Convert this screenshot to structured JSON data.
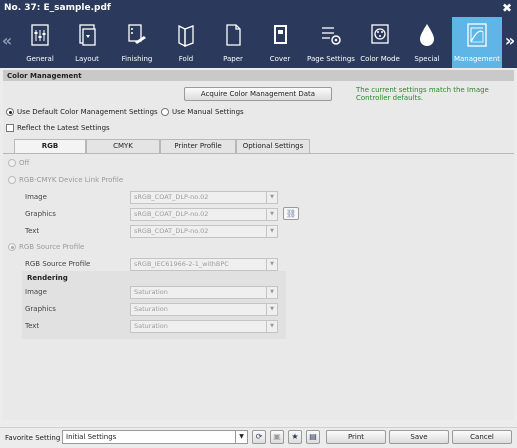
{
  "window": {
    "title": "No. 37: E_sample.pdf",
    "close_glyph": "✖"
  },
  "toolbar": {
    "nav_left_glyph": "«",
    "nav_right_glyph": "»",
    "items": [
      {
        "label": "General",
        "icon": "general-icon"
      },
      {
        "label": "Layout",
        "icon": "layout-icon"
      },
      {
        "label": "Finishing",
        "icon": "finishing-icon"
      },
      {
        "label": "Fold",
        "icon": "fold-icon"
      },
      {
        "label": "Paper",
        "icon": "paper-icon"
      },
      {
        "label": "Cover",
        "icon": "cover-icon"
      },
      {
        "label": "Page Settings",
        "icon": "page-settings-icon"
      },
      {
        "label": "Color Mode",
        "icon": "color-mode-icon"
      },
      {
        "label": "Special",
        "icon": "special-icon"
      },
      {
        "label": "Management",
        "icon": "management-icon",
        "active": true
      }
    ],
    "accent": "#5fb5e6",
    "background": "#2b3a5c"
  },
  "section": {
    "title": "Color Management"
  },
  "acquire_button": "Acquire Color Management Data",
  "status_note": "The current settings match the Image Controller defaults.",
  "mode": {
    "default_label": "Use Default Color Management Settings",
    "manual_label": "Use Manual Settings",
    "selected": "default"
  },
  "reflect_latest": {
    "label": "Reflect the Latest Settings",
    "checked": false
  },
  "tabs": [
    "RGB",
    "CMYK",
    "Printer Profile",
    "Optional Settings"
  ],
  "active_tab": "RGB",
  "rgb": {
    "off_label": "Off",
    "devlink_label": "RGB-CMYK Device Link Profile",
    "devlink_rows": [
      {
        "label": "Image",
        "value": "sRGB_COAT_DLP-no.02"
      },
      {
        "label": "Graphics",
        "value": "sRGB_COAT_DLP-no.02"
      },
      {
        "label": "Text",
        "value": "sRGB_COAT_DLP-no.02"
      }
    ],
    "source_label": "RGB Source Profile",
    "source_row": {
      "label": "RGB Source Profile",
      "value": "sRGB_IEC61966-2-1_withBPC"
    },
    "rendering_label": "Rendering",
    "rendering_rows": [
      {
        "label": "Image",
        "value": "Saturation"
      },
      {
        "label": "Graphics",
        "value": "Saturation"
      },
      {
        "label": "Text",
        "value": "Saturation"
      }
    ]
  },
  "footer": {
    "favorite_label": "Favorite Setting",
    "favorite_value": "Initial Settings",
    "print": "Print",
    "save": "Save",
    "cancel": "Cancel"
  }
}
